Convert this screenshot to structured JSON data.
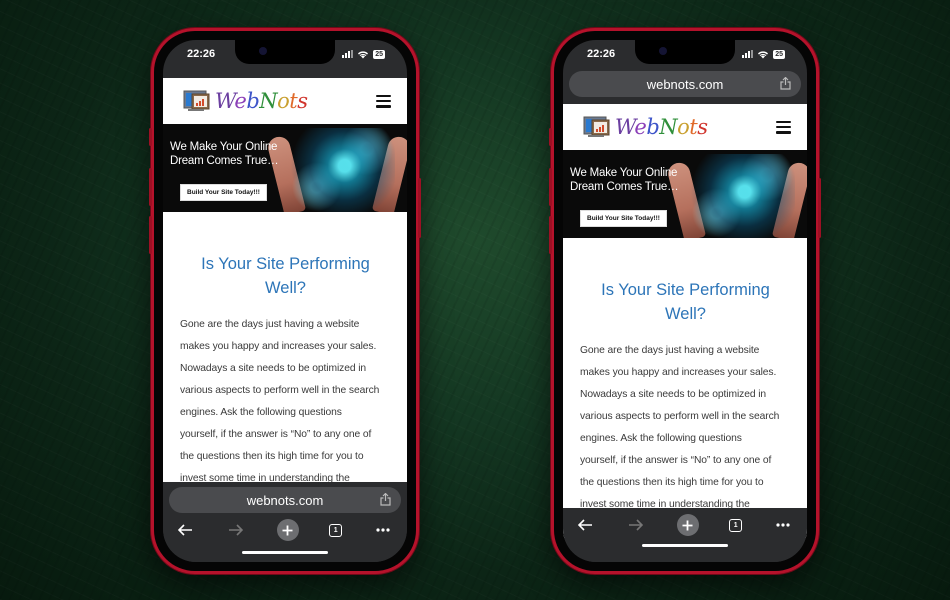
{
  "phones": [
    {
      "id": "left",
      "url_bar_position": "bottom",
      "status": {
        "time": "22:26",
        "battery": "25"
      },
      "url": "webnots.com",
      "site": {
        "logo_text": [
          "W",
          "e",
          "b",
          "N",
          "o",
          "t",
          "s"
        ],
        "banner_tagline_1": "We Make Your Online",
        "banner_tagline_2": "Dream Comes True…",
        "banner_cta": "Build Your Site Today!!!",
        "heading_1": "Is Your Site Performing",
        "heading_2": "Well?",
        "body_lines": [
          "Gone are the days just having a website",
          "makes you happy and increases your sales.",
          "Nowadays a site needs to be optimized in",
          "various aspects to perform well in the search",
          "engines. Ask the following questions",
          "yourself, if the answer is “No” to any one of",
          "the questions then its high time for you to",
          "invest some time in understanding the"
        ]
      },
      "toolbar": {
        "tab_count": "1"
      }
    },
    {
      "id": "right",
      "url_bar_position": "top",
      "status": {
        "time": "22:26",
        "battery": "25"
      },
      "url": "webnots.com",
      "site": {
        "logo_text": [
          "W",
          "e",
          "b",
          "N",
          "o",
          "t",
          "s"
        ],
        "banner_tagline_1": "We Make Your Online",
        "banner_tagline_2": "Dream Comes True…",
        "banner_cta": "Build Your Site Today!!!",
        "heading_1": "Is Your Site Performing",
        "heading_2": "Well?",
        "body_lines": [
          "Gone are the days just having a website",
          "makes you happy and increases your sales.",
          "Nowadays a site needs to be optimized in",
          "various aspects to perform well in the search",
          "engines. Ask the following questions",
          "yourself, if the answer is “No” to any one of",
          "the questions then its high time for you to",
          "invest some time in understanding the"
        ]
      },
      "toolbar": {
        "tab_count": "1"
      }
    }
  ],
  "icons": {
    "back": "arrow-left",
    "forward": "arrow-right",
    "new_tab": "plus",
    "tabs": "tab-count-square",
    "more": "ellipsis",
    "share": "share-up-arrow",
    "menu": "hamburger"
  },
  "colors": {
    "phone_frame": "#b5122b",
    "heading_blue": "#2d75b8",
    "browser_chrome": "#2b2c2e",
    "url_pill": "#4a4b4e"
  }
}
